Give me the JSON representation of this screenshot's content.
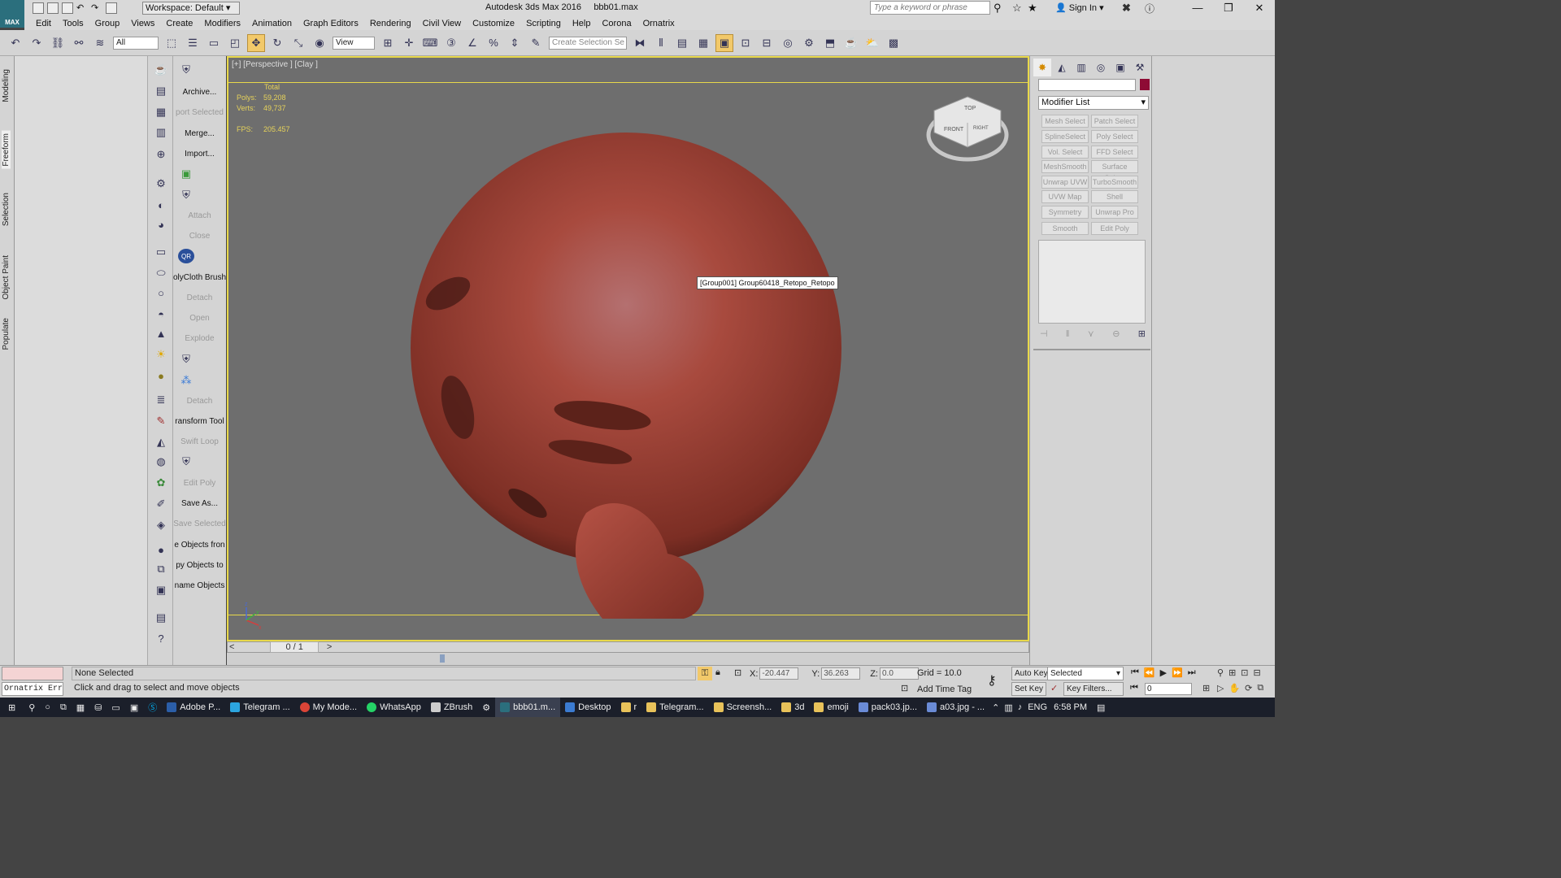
{
  "window": {
    "app_title": "Autodesk 3ds Max 2016",
    "file_name": "bbb01.max",
    "logo_text": "MAX",
    "workspace_label": "Workspace: Default",
    "search_placeholder": "Type a keyword or phrase",
    "sign_in": "Sign In",
    "min": "—",
    "max": "❐",
    "close": "✕"
  },
  "menu": [
    "Edit",
    "Tools",
    "Group",
    "Views",
    "Create",
    "Modifiers",
    "Animation",
    "Graph Editors",
    "Rendering",
    "Civil View",
    "Customize",
    "Scripting",
    "Help",
    "Corona",
    "Ornatrix"
  ],
  "toolbar": {
    "filter": "All",
    "ref_coord": "View",
    "selection_set_placeholder": "Create Selection Se"
  },
  "left_tabs": [
    "Modeling",
    "Freeform",
    "Selection",
    "Object Paint",
    "Populate"
  ],
  "commands": [
    {
      "label": "Archive...",
      "enabled": true
    },
    {
      "label": "port Selected",
      "enabled": false
    },
    {
      "label": "Merge...",
      "enabled": true
    },
    {
      "label": "Import...",
      "enabled": true
    },
    {
      "label": "Attach",
      "enabled": false
    },
    {
      "label": "Close",
      "enabled": false
    },
    {
      "label": "olyCloth Brush",
      "enabled": true
    },
    {
      "label": "Detach",
      "enabled": false
    },
    {
      "label": "Open",
      "enabled": false
    },
    {
      "label": "Explode",
      "enabled": false
    },
    {
      "label": "Detach",
      "enabled": false
    },
    {
      "label": "ransform Tool",
      "enabled": true
    },
    {
      "label": "Swift Loop",
      "enabled": false
    },
    {
      "label": "Edit Poly",
      "enabled": false
    },
    {
      "label": "Save As...",
      "enabled": true
    },
    {
      "label": "Save Selected",
      "enabled": false
    },
    {
      "label": "e Objects fron",
      "enabled": true
    },
    {
      "label": "py Objects to",
      "enabled": true
    },
    {
      "label": "name Objects",
      "enabled": true
    }
  ],
  "viewport": {
    "label": "[+] [Perspective ] [Clay ]",
    "stats_header": "Total",
    "polys_label": "Polys:",
    "polys": "59,208",
    "verts_label": "Verts:",
    "verts": "49,737",
    "fps_label": "FPS:",
    "fps": "205.457",
    "tooltip": "[Group001] Group60418_Retopo_Retopo",
    "viewcube_top": "TOP",
    "viewcube_front": "FRONT",
    "viewcube_right": "RIGHT",
    "axis_z": "z",
    "axis_x": "x",
    "axis_y": "y",
    "accent": "#e8d84a",
    "object_color": "#b0473c"
  },
  "timeline": {
    "frame": "0 / 1",
    "prev": "<",
    "next": ">"
  },
  "command_panel": {
    "modifier_list": "Modifier List",
    "object_color": "#8e0b35",
    "modifiers": [
      "Mesh Select",
      "Patch Select",
      "SplineSelect",
      "Poly Select",
      "Vol. Select",
      "FFD Select",
      "MeshSmooth",
      "Surface Select",
      "Unwrap UVW",
      "TurboSmooth",
      "UVW Map",
      "Shell",
      "Symmetry",
      "Unwrap Pro",
      "Smooth",
      "Edit Poly"
    ]
  },
  "status": {
    "script_output": "Ornatrix Err(",
    "selection": "None Selected",
    "prompt": "Click and drag to select and move objects",
    "x_label": "X:",
    "x": "-20.447",
    "y_label": "Y:",
    "y": "36.263",
    "z_label": "Z:",
    "z": "0.0",
    "grid": "Grid = 10.0",
    "auto_key": "Auto Key",
    "set_key": "Set Key",
    "selected": "Selected",
    "key_filters": "Key Filters...",
    "add_time_tag": "Add Time Tag",
    "frame_field": "0"
  },
  "taskbar": {
    "items": [
      {
        "label": "Adobe P...",
        "color": "#2b5ea8",
        "active": false
      },
      {
        "label": "Telegram ...",
        "color": "#2ca5e0",
        "active": false
      },
      {
        "label": "My Mode...",
        "color": "#db4437",
        "active": false
      },
      {
        "label": "WhatsApp",
        "color": "#25d366",
        "active": false
      },
      {
        "label": "ZBrush",
        "color": "#cccccc",
        "active": false
      },
      {
        "label": "bbb01.m...",
        "color": "#2b6f7d",
        "active": true
      },
      {
        "label": "Desktop",
        "color": "#3b7bd1",
        "active": false
      },
      {
        "label": "r",
        "color": "#e8c25a",
        "active": false
      },
      {
        "label": "Telegram...",
        "color": "#e8c25a",
        "active": false
      },
      {
        "label": "Screensh...",
        "color": "#e8c25a",
        "active": false
      },
      {
        "label": "3d",
        "color": "#e8c25a",
        "active": false
      },
      {
        "label": "emoji",
        "color": "#e8c25a",
        "active": false
      },
      {
        "label": "pack03.jp...",
        "color": "#6a8bd6",
        "active": false
      },
      {
        "label": "a03.jpg - ...",
        "color": "#6a8bd6",
        "active": false
      }
    ],
    "language": "ENG",
    "time": "6:58 PM"
  }
}
